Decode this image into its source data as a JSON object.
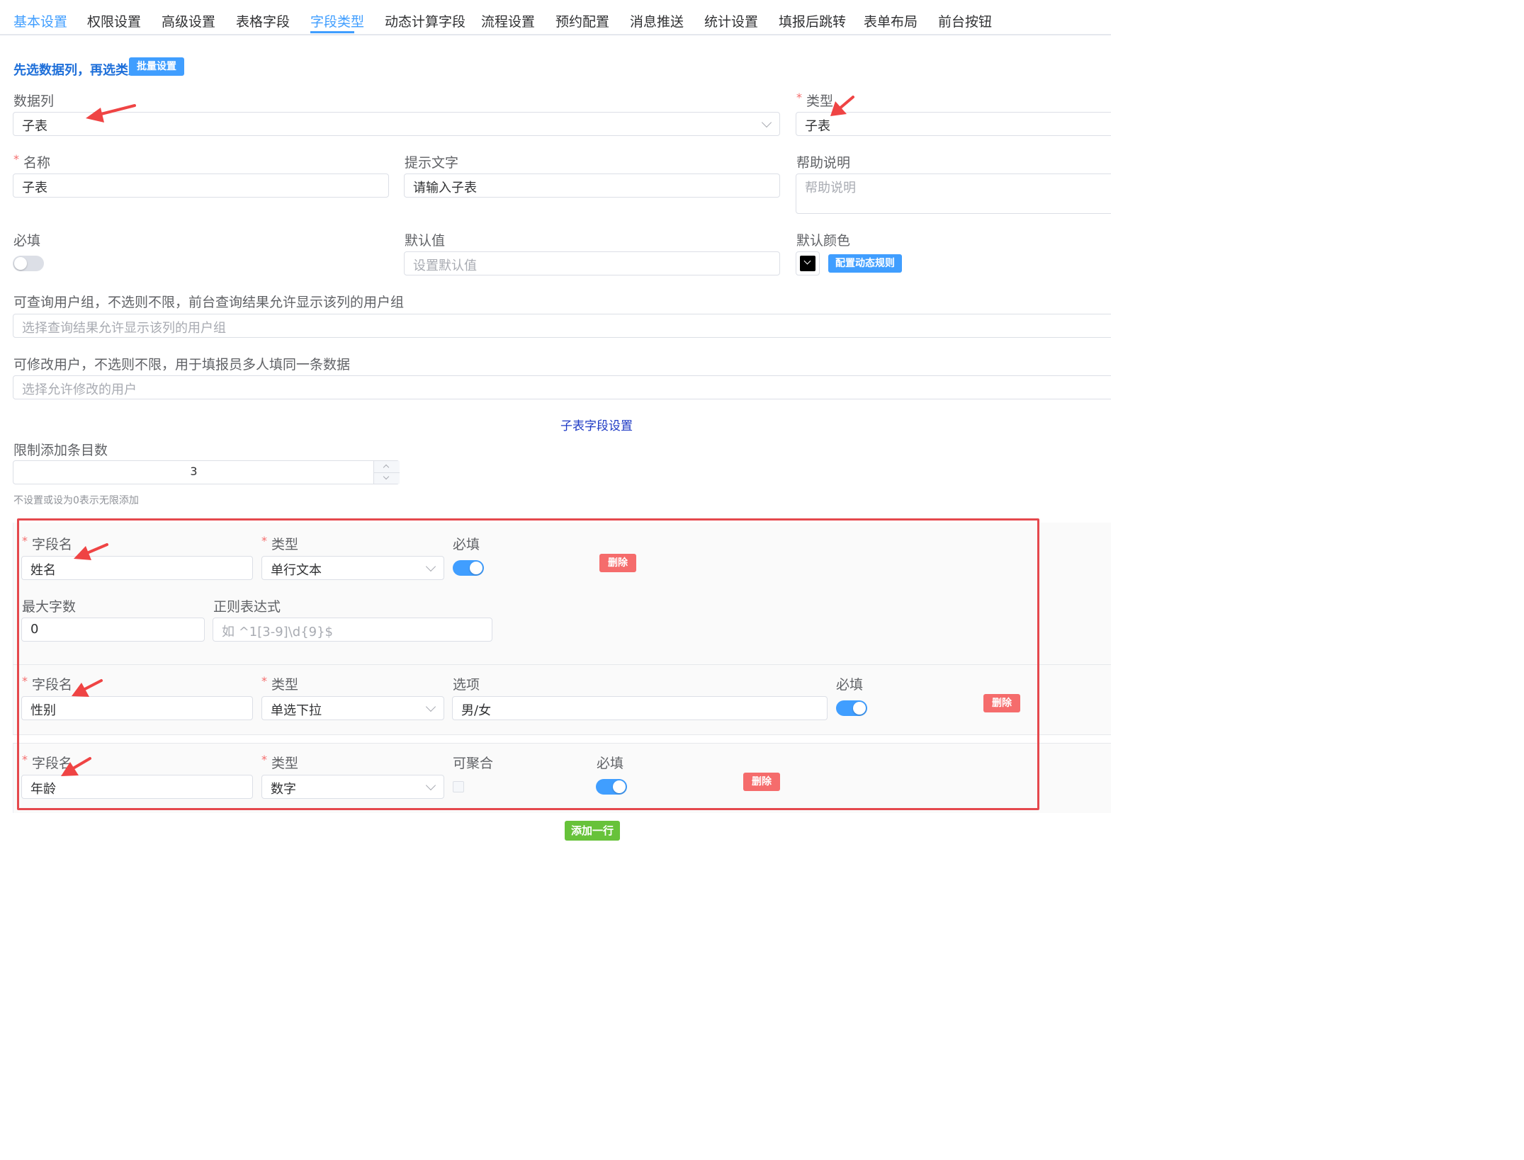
{
  "tabs": [
    "基本设置",
    "权限设置",
    "高级设置",
    "表格字段",
    "字段类型",
    "动态计算字段",
    "流程设置",
    "预约配置",
    "消息推送",
    "统计设置",
    "填报后跳转",
    "表单布局",
    "前台按钮"
  ],
  "active_tab": "字段类型",
  "colors": {
    "primary": "#409eff",
    "danger": "#f56c6c",
    "success": "#67c23a",
    "annotation": "#e5484d"
  },
  "batch": {
    "hint": "先选数据列，再选类型",
    "button": "批量设置"
  },
  "form": {
    "data_column": {
      "label": "数据列",
      "value": "子表"
    },
    "type": {
      "label": "类型",
      "value": "子表"
    },
    "name": {
      "label": "名称",
      "value": "子表"
    },
    "prompt": {
      "label": "提示文字",
      "value": "请输入子表"
    },
    "help": {
      "label": "帮助说明",
      "placeholder": "帮助说明"
    },
    "required": {
      "label": "必填",
      "on": false
    },
    "default_value": {
      "label": "默认值",
      "placeholder": "设置默认值"
    },
    "default_color": {
      "label": "默认颜色",
      "swatch": "#000000",
      "rule_button": "配置动态规则"
    },
    "query_groups": {
      "label": "可查询用户组，不选则不限，前台查询结果允许显示该列的用户组",
      "placeholder": "选择查询结果允许显示该列的用户组"
    },
    "edit_users": {
      "label": "可修改用户，不选则不限，用于填报员多人填同一条数据",
      "placeholder": "选择允许修改的用户"
    }
  },
  "subtable": {
    "section_title": "子表字段设置",
    "limit": {
      "label": "限制添加条目数",
      "value": "3",
      "hint": "不设置或设为0表示无限添加"
    },
    "rows": [
      {
        "field_name_label": "字段名",
        "field_name": "姓名",
        "type_label": "类型",
        "type": "单行文本",
        "required_label": "必填",
        "required": true,
        "delete": "删除",
        "max_chars_label": "最大字数",
        "max_chars": "0",
        "regex_label": "正则表达式",
        "regex_placeholder": "如 ^1[3-9]\\d{9}$"
      },
      {
        "field_name_label": "字段名",
        "field_name": "性别",
        "type_label": "类型",
        "type": "单选下拉",
        "options_label": "选项",
        "options": "男/女",
        "required_label": "必填",
        "required": true,
        "delete": "删除"
      },
      {
        "field_name_label": "字段名",
        "field_name": "年龄",
        "type_label": "类型",
        "type": "数字",
        "aggregatable_label": "可聚合",
        "aggregatable": false,
        "required_label": "必填",
        "required": true,
        "delete": "删除"
      }
    ],
    "add_row": "添加一行"
  }
}
